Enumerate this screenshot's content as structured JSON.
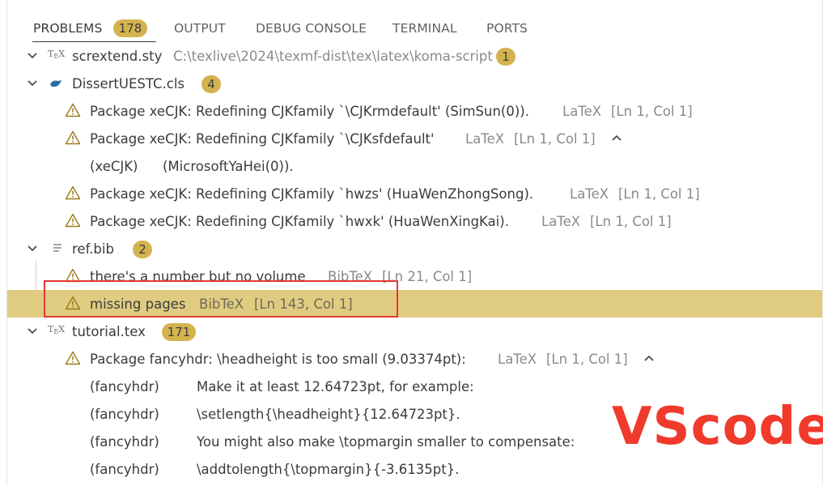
{
  "tabs": [
    {
      "label": "PROBLEMS",
      "count": "178",
      "active": true
    },
    {
      "label": "OUTPUT"
    },
    {
      "label": "DEBUG CONSOLE"
    },
    {
      "label": "TERMINAL"
    },
    {
      "label": "PORTS"
    }
  ],
  "files": {
    "scrextend": {
      "name": "scrextend.sty",
      "path": "C:\\texlive\\2024\\texmf-dist\\tex\\latex\\koma-script",
      "count": "1"
    },
    "dissert": {
      "name": "DissertUESTC.cls",
      "count": "4"
    },
    "refbib": {
      "name": "ref.bib",
      "count": "2"
    },
    "tutorial": {
      "name": "tutorial.tex",
      "count": "171"
    }
  },
  "problems": {
    "p1": {
      "message": "Package xeCJK: Redefining CJKfamily `\\CJKrmdefault' (SimSun(0)).",
      "source": "LaTeX",
      "location": "[Ln 1, Col 1]"
    },
    "p2": {
      "message": "Package xeCJK: Redefining CJKfamily `\\CJKsfdefault'",
      "source": "LaTeX",
      "location": "[Ln 1, Col 1]",
      "cont1": "(xeCJK)",
      "cont2": "(MicrosoftYaHei(0))."
    },
    "p3": {
      "message": "Package xeCJK: Redefining CJKfamily `hwzs' (HuaWenZhongSong).",
      "source": "LaTeX",
      "location": "[Ln 1, Col 1]"
    },
    "p4": {
      "message": "Package xeCJK: Redefining CJKfamily `hwxk' (HuaWenXingKai).",
      "source": "LaTeX",
      "location": "[Ln 1, Col 1]"
    },
    "p5": {
      "message": "there's a number but no volume",
      "source": "BibTeX",
      "location": "[Ln 21, Col 1]"
    },
    "p6": {
      "message": "missing pages",
      "source": "BibTeX",
      "location": "[Ln 143, Col 1]"
    },
    "p7": {
      "message": "Package fancyhdr: \\headheight is too small (9.03374pt):",
      "source": "LaTeX",
      "location": "[Ln 1, Col 1]",
      "lines": [
        {
          "prefix": "(fancyhdr)",
          "text": "Make it at least 12.64723pt, for example:"
        },
        {
          "prefix": "(fancyhdr)",
          "text": "\\setlength{\\headheight}{12.64723pt}."
        },
        {
          "prefix": "(fancyhdr)",
          "text": "You might also make \\topmargin smaller to compensate:"
        },
        {
          "prefix": "(fancyhdr)",
          "text": "\\addtolength{\\topmargin}{-3.6135pt}."
        }
      ]
    }
  },
  "watermark": "VScode",
  "colors": {
    "badge": "#d4b34e",
    "selected_row": "#e0cc80",
    "warning_icon": "#9a7a1a",
    "annotation": "#e53935"
  }
}
